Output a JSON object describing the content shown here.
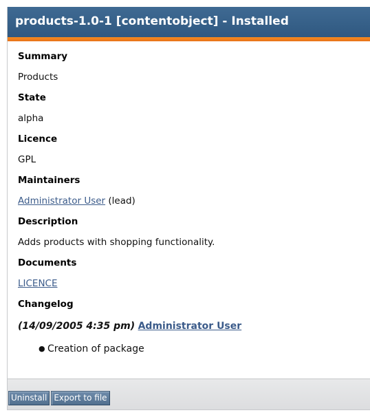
{
  "header": {
    "title": "products-1.0-1 [contentobject] - Installed"
  },
  "details": {
    "summary_label": "Summary",
    "summary_value": "Products",
    "state_label": "State",
    "state_value": "alpha",
    "licence_label": "Licence",
    "licence_value": "GPL",
    "maintainers_label": "Maintainers",
    "maintainer_name": "Administrator User",
    "maintainer_role": "(lead)",
    "description_label": "Description",
    "description_value": "Adds products with shopping functionality.",
    "documents_label": "Documents",
    "document_link": "LICENCE",
    "changelog_label": "Changelog"
  },
  "changelog": {
    "date": "(14/09/2005 4:35 pm)",
    "author": "Administrator User",
    "changes": [
      "Creation of package"
    ]
  },
  "buttons": {
    "uninstall": "Uninstall",
    "export": "Export to file"
  },
  "colors": {
    "header_bg": "#355f88",
    "accent_strip": "#f0801d",
    "link": "#3b5b8a",
    "button_bg": "#5f7d9d"
  }
}
